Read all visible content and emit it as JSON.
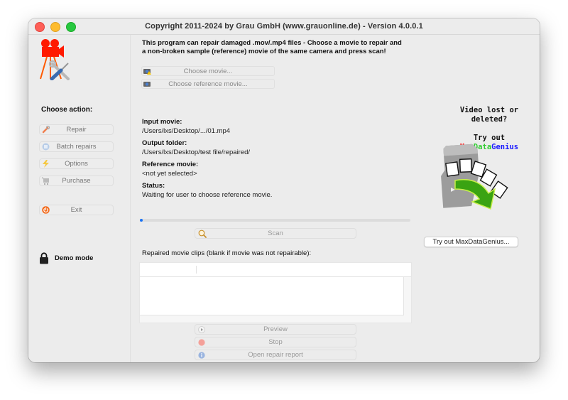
{
  "window": {
    "title": "Copyright 2011-2024 by Grau GmbH (www.grauonline.de) - Version 4.0.0.1"
  },
  "sidebar": {
    "choose_action_label": "Choose action:",
    "items": [
      {
        "label": "Repair",
        "icon": "wrench-icon"
      },
      {
        "label": "Batch repairs",
        "icon": "batch-icon"
      },
      {
        "label": "Options",
        "icon": "lightning-icon"
      },
      {
        "label": "Purchase",
        "icon": "cart-icon"
      }
    ],
    "exit_label": "Exit",
    "demo_mode_label": "Demo mode"
  },
  "main": {
    "intro_line1": "This program can repair damaged .mov/.mp4 files - Choose a movie to repair and",
    "intro_line2": "a non-broken sample (reference) movie of the same camera and press scan!",
    "choose_movie_label": "Choose movie...",
    "choose_reference_label": "Choose reference movie...",
    "input_movie_label": "Input movie:",
    "input_movie_value": "/Users/lxs/Desktop/.../01.mp4",
    "output_folder_label": "Output folder:",
    "output_folder_value": "/Users/lxs/Desktop/test file/repaired/",
    "reference_movie_label": "Reference movie:",
    "reference_movie_value": "<not yet selected>",
    "status_label": "Status:",
    "status_value": "Waiting for user to choose reference movie.",
    "progress_percent": 1,
    "scan_label": "Scan",
    "clips_label": "Repaired movie clips (blank if movie was not repairable):",
    "clips_rows": [],
    "preview_label": "Preview",
    "stop_label": "Stop",
    "open_report_label": "Open repair report"
  },
  "ad": {
    "line1": "Video lost or",
    "line2": "deleted?",
    "line3": "Try out",
    "brand_part1": "Max",
    "brand_part2": "Data",
    "brand_part3": "Genius",
    "brand_colors": [
      "#ff1a1a",
      "#33cc33",
      "#1a1aff"
    ],
    "button_label": "Try out MaxDataGenius..."
  }
}
